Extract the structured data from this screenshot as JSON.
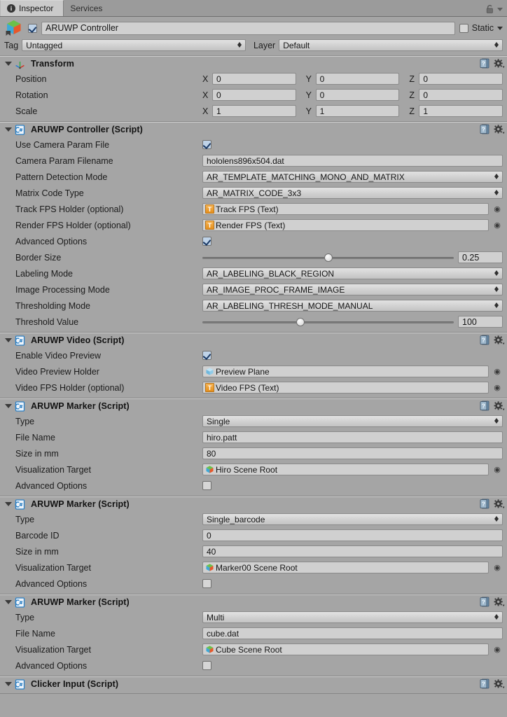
{
  "window": {
    "tabs": [
      {
        "label": "Inspector",
        "active": true,
        "icon": "info-icon"
      },
      {
        "label": "Services",
        "active": false,
        "icon": null
      }
    ],
    "lock_icon": "padlock-icon",
    "menu_icon": "chevron-down-icon"
  },
  "gameobject": {
    "icon": "prefab-cube-icon",
    "enabled": true,
    "name": "ARUWP Controller",
    "static_label": "Static",
    "static_checked": false,
    "tag_label": "Tag",
    "tag_value": "Untagged",
    "layer_label": "Layer",
    "layer_value": "Default"
  },
  "components": [
    {
      "title": "Transform",
      "icon": "transform-axis-icon",
      "help_icon": "help-book-icon",
      "gear_icon": "gear-icon",
      "rows": [
        {
          "kind": "vector3",
          "name": "Position",
          "axes": [
            "X",
            "Y",
            "Z"
          ],
          "values": [
            "0",
            "0",
            "0"
          ]
        },
        {
          "kind": "vector3",
          "name": "Rotation",
          "axes": [
            "X",
            "Y",
            "Z"
          ],
          "values": [
            "0",
            "0",
            "0"
          ]
        },
        {
          "kind": "vector3",
          "name": "Scale",
          "axes": [
            "X",
            "Y",
            "Z"
          ],
          "values": [
            "1",
            "1",
            "1"
          ]
        }
      ]
    },
    {
      "title": "ARUWP Controller (Script)",
      "icon": "csharp-script-icon",
      "help_icon": "help-book-icon",
      "gear_icon": "gear-icon",
      "rows": [
        {
          "kind": "checkbox",
          "name": "Use Camera Param File",
          "checked": true
        },
        {
          "kind": "text",
          "name": "Camera Param Filename",
          "value": "hololens896x504.dat"
        },
        {
          "kind": "dropdown",
          "name": "Pattern Detection Mode",
          "value": "AR_TEMPLATE_MATCHING_MONO_AND_MATRIX"
        },
        {
          "kind": "dropdown",
          "name": "Matrix Code Type",
          "value": "AR_MATRIX_CODE_3x3"
        },
        {
          "kind": "object",
          "name": "Track FPS Holder (optional)",
          "value": "Track FPS (Text)",
          "icon": "text-component-icon"
        },
        {
          "kind": "object",
          "name": "Render FPS Holder (optional)",
          "value": "Render FPS (Text)",
          "icon": "text-component-icon"
        },
        {
          "kind": "checkbox",
          "name": "Advanced Options",
          "checked": true
        },
        {
          "kind": "slider",
          "name": "Border Size",
          "value": "0.25",
          "percent": 50
        },
        {
          "kind": "dropdown",
          "name": "Labeling Mode",
          "value": "AR_LABELING_BLACK_REGION"
        },
        {
          "kind": "dropdown",
          "name": "Image Processing Mode",
          "value": "AR_IMAGE_PROC_FRAME_IMAGE"
        },
        {
          "kind": "dropdown",
          "name": "Thresholding Mode",
          "value": "AR_LABELING_THRESH_MODE_MANUAL"
        },
        {
          "kind": "slider",
          "name": "Threshold Value",
          "value": "100",
          "percent": 39
        }
      ]
    },
    {
      "title": "ARUWP Video (Script)",
      "icon": "csharp-script-icon",
      "help_icon": "help-book-icon",
      "gear_icon": "gear-icon",
      "rows": [
        {
          "kind": "checkbox",
          "name": "Enable Video Preview",
          "checked": true
        },
        {
          "kind": "object",
          "name": "Video Preview Holder",
          "value": "Preview Plane",
          "icon": "gameobject-cube-icon"
        },
        {
          "kind": "object",
          "name": "Video FPS Holder (optional)",
          "value": "Video FPS (Text)",
          "icon": "text-component-icon"
        }
      ]
    },
    {
      "title": "ARUWP Marker (Script)",
      "icon": "csharp-script-icon",
      "help_icon": "help-book-icon",
      "gear_icon": "gear-icon",
      "rows": [
        {
          "kind": "dropdown",
          "name": "Type",
          "value": "Single"
        },
        {
          "kind": "text",
          "name": "File Name",
          "value": "hiro.patt"
        },
        {
          "kind": "text",
          "name": "Size in mm",
          "value": "80"
        },
        {
          "kind": "object",
          "name": "Visualization Target",
          "value": "Hiro Scene Root",
          "icon": "prefab-cube-icon"
        },
        {
          "kind": "checkbox",
          "name": "Advanced Options",
          "checked": false
        }
      ]
    },
    {
      "title": "ARUWP Marker (Script)",
      "icon": "csharp-script-icon",
      "help_icon": "help-book-icon",
      "gear_icon": "gear-icon",
      "rows": [
        {
          "kind": "dropdown",
          "name": "Type",
          "value": "Single_barcode"
        },
        {
          "kind": "text",
          "name": "Barcode ID",
          "value": "0"
        },
        {
          "kind": "text",
          "name": "Size in mm",
          "value": "40"
        },
        {
          "kind": "object",
          "name": "Visualization Target",
          "value": "Marker00 Scene Root",
          "icon": "prefab-cube-icon"
        },
        {
          "kind": "checkbox",
          "name": "Advanced Options",
          "checked": false
        }
      ]
    },
    {
      "title": "ARUWP Marker (Script)",
      "icon": "csharp-script-icon",
      "help_icon": "help-book-icon",
      "gear_icon": "gear-icon",
      "rows": [
        {
          "kind": "dropdown",
          "name": "Type",
          "value": "Multi"
        },
        {
          "kind": "text",
          "name": "File Name",
          "value": "cube.dat"
        },
        {
          "kind": "object",
          "name": "Visualization Target",
          "value": "Cube Scene Root",
          "icon": "prefab-cube-icon"
        },
        {
          "kind": "checkbox",
          "name": "Advanced Options",
          "checked": false
        }
      ]
    },
    {
      "title": "Clicker Input (Script)",
      "icon": "csharp-script-icon",
      "help_icon": "help-book-icon",
      "gear_icon": "gear-icon",
      "clipped": true,
      "rows": []
    }
  ],
  "colors": {
    "panel_bg": "#a5a5a5",
    "field_bg": "#d0d0d0",
    "checkbox_accent": "#bfd3e8",
    "text_icon_orange": "#e58f1c",
    "script_icon_blue": "#2b7fc4"
  }
}
